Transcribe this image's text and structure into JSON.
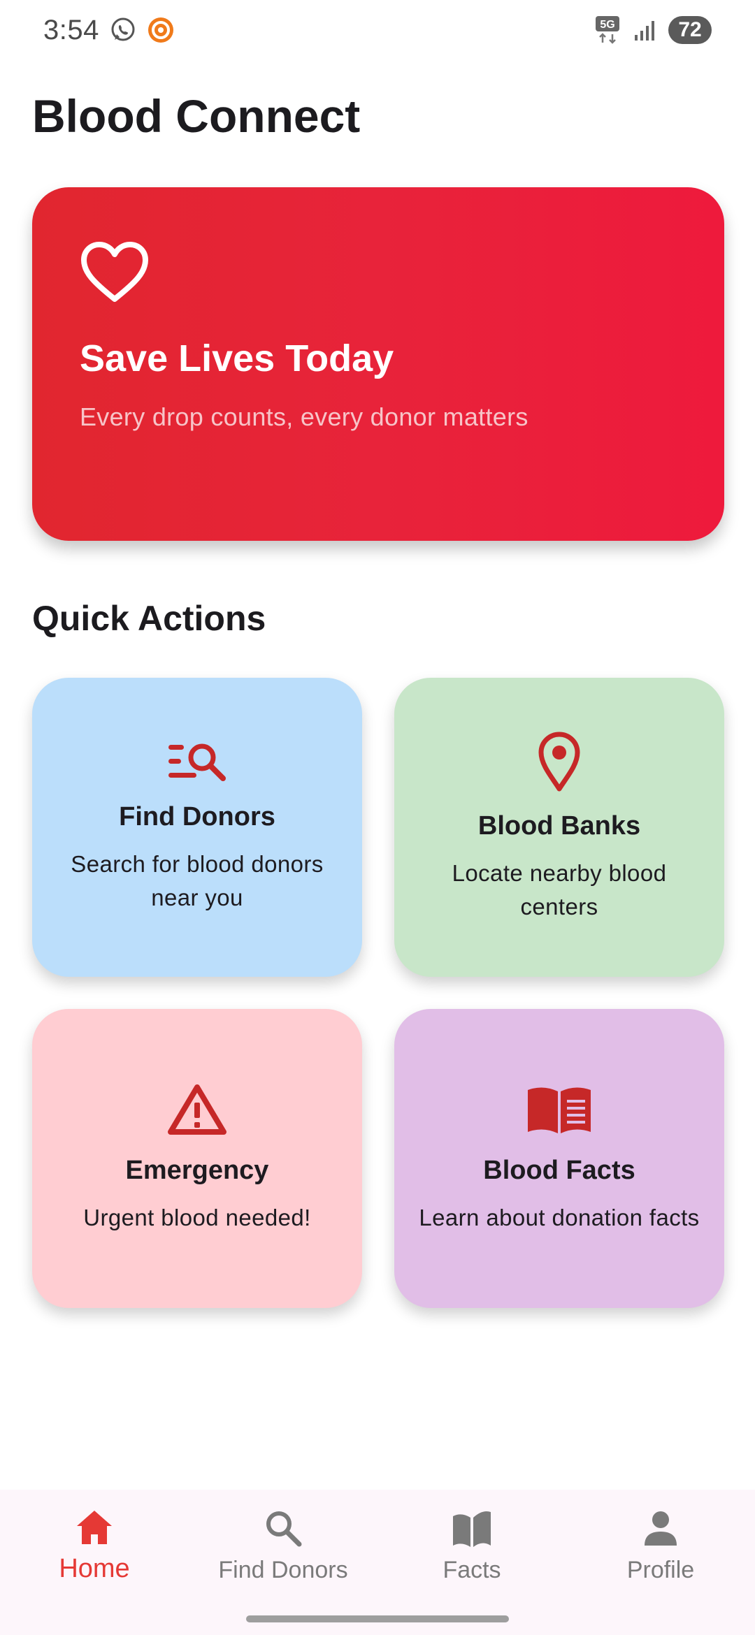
{
  "status_bar": {
    "time": "3:54",
    "network": "5G",
    "battery": "72"
  },
  "app": {
    "title": "Blood Connect"
  },
  "hero": {
    "icon": "heart-outline-icon",
    "title": "Save Lives Today",
    "subtitle": "Every drop counts, every donor matters"
  },
  "quick_actions": {
    "heading": "Quick Actions",
    "cards": [
      {
        "icon": "search-list-icon",
        "title": "Find Donors",
        "desc": "Search for blood donors near you",
        "bg": "#bbdefb"
      },
      {
        "icon": "location-pin-icon",
        "title": "Blood Banks",
        "desc": "Locate nearby blood centers",
        "bg": "#c8e6c9"
      },
      {
        "icon": "warning-icon",
        "title": "Emergency",
        "desc": "Urgent blood needed!",
        "bg": "#ffcdd2"
      },
      {
        "icon": "book-icon",
        "title": "Blood Facts",
        "desc": "Learn about donation facts",
        "bg": "#e1bee7"
      }
    ]
  },
  "bottom_nav": {
    "items": [
      {
        "label": "Home",
        "icon": "home-icon",
        "active": true
      },
      {
        "label": "Find Donors",
        "icon": "search-icon",
        "active": false
      },
      {
        "label": "Facts",
        "icon": "book-icon",
        "active": false
      },
      {
        "label": "Profile",
        "icon": "person-icon",
        "active": false
      }
    ]
  },
  "colors": {
    "accent": "#c62828",
    "hero_start": "#e1262f",
    "hero_end": "#ee1a3c",
    "nav_active": "#e53935",
    "nav_inactive": "#7a7a7a"
  }
}
